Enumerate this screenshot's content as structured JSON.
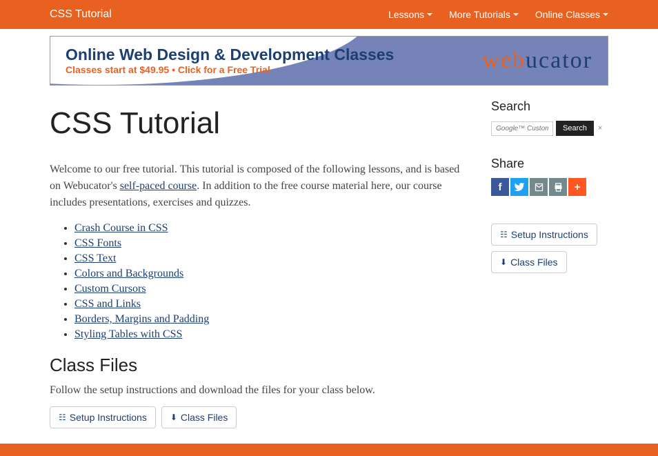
{
  "nav": {
    "brand": "CSS Tutorial",
    "items": [
      "Lessons",
      "More Tutorials",
      "Online Classes"
    ]
  },
  "banner": {
    "title": "Online Web Design & Development Classes",
    "subtitle": "Classes start at $49.95 • Click for a Free Trial",
    "logo_pre": "web",
    "logo_post": "ucator"
  },
  "page": {
    "title": "CSS Tutorial",
    "intro_pre": "Welcome to our free tutorial. This tutorial is composed of the following lessons, and is based on Webucator's ",
    "intro_link": "self-paced course",
    "intro_post": ". In addition to the free course material here, our course includes presentations, exercises and quizzes.",
    "lessons": [
      "Crash Course in CSS",
      "CSS Fonts",
      "CSS Text",
      "Colors and Backgrounds",
      "Custom Cursors",
      "CSS and Links",
      "Borders, Margins and Padding",
      "Styling Tables with CSS"
    ],
    "classfiles_heading": "Class Files",
    "classfiles_text": "Follow the setup instructions and download the files for your class below.",
    "setup_btn": "Setup Instructions",
    "files_btn": "Class Files"
  },
  "sidebar": {
    "search_heading": "Search",
    "search_placeholder": "Google™ Custom Sea",
    "search_btn": "Search",
    "close": "×",
    "share_heading": "Share",
    "setup_btn": "Setup Instructions",
    "files_btn": "Class Files"
  }
}
